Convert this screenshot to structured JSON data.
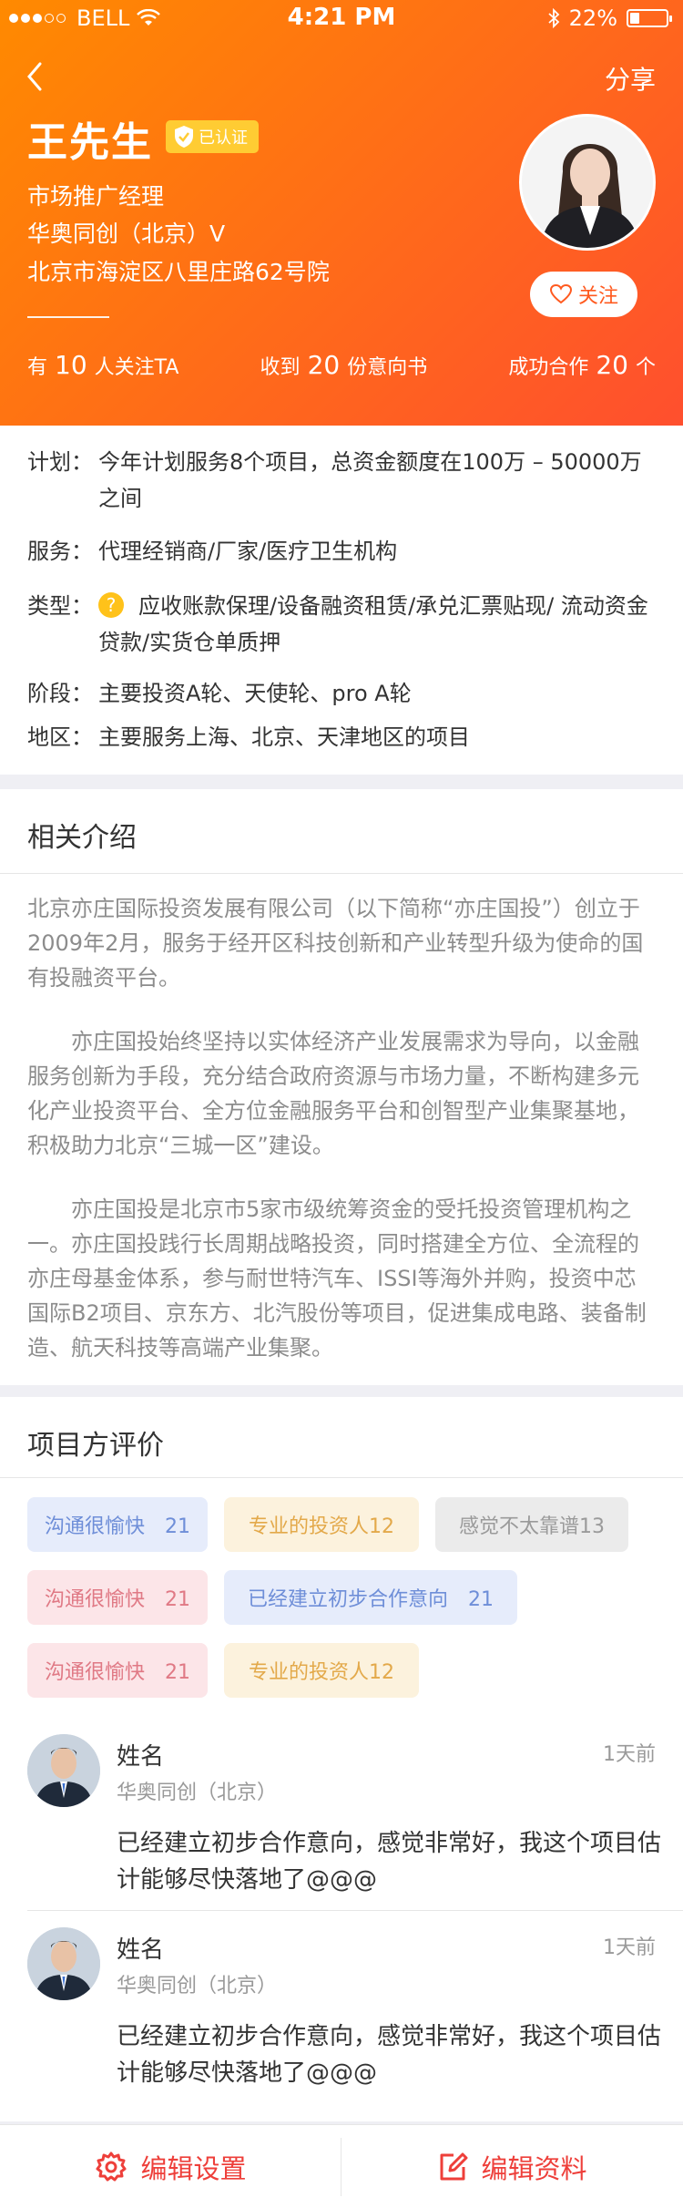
{
  "status_bar": {
    "carrier": "BELL",
    "time": "4:21 PM",
    "battery": "22%"
  },
  "header": {
    "share_label": "分享",
    "name": "王先生",
    "verified_label": "已认证",
    "title": "市场推广经理",
    "company": "华奥同创（北京）V",
    "address": "北京市海淀区八里庄路62号院",
    "follow_label": "关注",
    "stats": {
      "followers_prefix": "有",
      "followers_count": "10",
      "followers_suffix": "人关注TA",
      "intents_prefix": "收到",
      "intents_count": "20",
      "intents_suffix": "份意向书",
      "coop_prefix": "成功合作",
      "coop_count": "20",
      "coop_suffix": "个"
    }
  },
  "plan": {
    "plan_label": "计划：",
    "plan_value": "今年计划服务8个项目，总资金额度在100万 – 50000万之间",
    "service_label": "服务：",
    "service_value": "代理经销商/厂家/医疗卫生机构",
    "type_label": "类型：",
    "type_value": "应收账款保理/设备融资租赁/承兑汇票贴现/ 流动资金贷款/实货仓单质押",
    "stage_label": "阶段：",
    "stage_value": "主要投资A轮、天使轮、pro A轮",
    "region_label": "地区：",
    "region_value": "主要服务上海、北京、天津地区的项目"
  },
  "intro": {
    "title": "相关介绍",
    "p1": "北京亦庄国际投资发展有限公司（以下简称“亦庄国投”）创立于2009年2月，服务于经开区科技创新和产业转型升级为使命的国有投融资平台。",
    "p2": "　　亦庄国投始终坚持以实体经济产业发展需求为导向，以金融服务创新为手段，充分结合政府资源与市场力量，不断构建多元化产业投资平台、全方位金融服务平台和创智型产业集聚基地，积极助力北京“三城一区”建设。",
    "p3": "　　亦庄国投是北京市5家市级统筹资金的受托投资管理机构之一。亦庄国投践行长周期战略投资，同时搭建全方位、全流程的亦庄母基金体系，参与耐世特汽车、ISSI等海外并购，投资中芯国际B2项目、京东方、北汽股份等项目，促进集成电路、装备制造、航天科技等高端产业集聚。"
  },
  "evaluation": {
    "title": "项目方评价",
    "tags": [
      {
        "label": "沟通很愉快　21"
      },
      {
        "label": "专业的投资人12"
      },
      {
        "label": "感觉不太靠谱13"
      },
      {
        "label": "沟通很愉快　21"
      },
      {
        "label": "已经建立初步合作意向　21"
      },
      {
        "label": "沟通很愉快　21"
      },
      {
        "label": "专业的投资人12"
      }
    ],
    "tag_colors": {
      "blue": "#e6ecfb",
      "yellow": "#fcf2dd",
      "gray": "#ebebeb",
      "pink": "#fce5e8"
    },
    "comments": [
      {
        "name": "姓名",
        "company": "华奥同创（北京）",
        "time": "1天前",
        "text": "已经建立初步合作意向，感觉非常好，我这个项目估计能够尽快落地了@@@"
      },
      {
        "name": "姓名",
        "company": "华奥同创（北京）",
        "time": "1天前",
        "text": "已经建立初步合作意向，感觉非常好，我这个项目估计能够尽快落地了@@@"
      }
    ]
  },
  "bottom_bar": {
    "edit_settings": "编辑设置",
    "edit_profile": "编辑资料",
    "accent_color": "#ee3f3a"
  },
  "icons": [
    "signal-dots-icon",
    "wifi-icon",
    "bluetooth-icon",
    "battery-icon",
    "back-chevron-icon",
    "shield-check-icon",
    "heart-icon",
    "question-icon",
    "gear-icon",
    "edit-icon"
  ]
}
